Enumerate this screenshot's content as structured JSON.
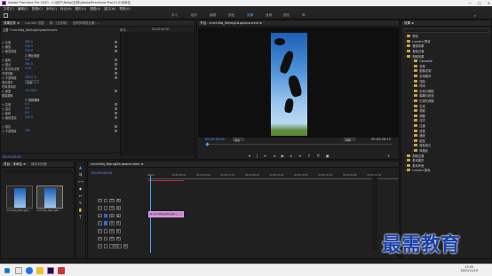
{
  "window": {
    "title": "Adobe Premiere Pro 2020 - C:\\用户\\ftdop\\文档\\Adobe\\Premiere Pro\\14.0\\未命名",
    "controls": [
      "—",
      "□",
      "✕"
    ]
  },
  "menu": [
    "文件(F)",
    "编辑(E)",
    "剪辑(C)",
    "序列(S)",
    "标记(M)",
    "图形(G)",
    "视图(V)",
    "窗口(W)",
    "帮助(H)"
  ],
  "workspaces": [
    {
      "label": "学习",
      "active": false
    },
    {
      "label": "组件",
      "active": false
    },
    {
      "label": "编辑",
      "active": false
    },
    {
      "label": "颜色",
      "active": false
    },
    {
      "label": "效果",
      "active": true
    },
    {
      "label": "音频",
      "active": false
    },
    {
      "label": "图形",
      "active": false
    },
    {
      "label": "库",
      "active": false
    }
  ],
  "effect_controls": {
    "tabs": [
      "效果控件 ≡",
      "Lumetri 范围",
      "源：(无剪辑)",
      "音频剪辑混合器: ..."
    ],
    "clip": "主要 * cnrcrVdq_Stering2d.peacro.mmi",
    "seq": "序列 ...",
    "time": "00:00:00:00",
    "rows": [
      {
        "label": "○ 位置",
        "value": "360.0"
      },
      {
        "label": "○ 缩放",
        "value": "100.0"
      },
      {
        "label": "○ 缩放宽度",
        "value": "100.0"
      },
      {
        "label": "",
        "value": "☑ 等比缩放"
      },
      {
        "label": "○ 旋转",
        "value": "0.0"
      },
      {
        "label": "○ 锚点",
        "value": "360.0"
      },
      {
        "label": "○ 防闪烁滤镜",
        "value": "0.00"
      },
      {
        "label": "不透明度",
        "value": ""
      },
      {
        "label": "○ 不透明度",
        "value": "100.0 %"
      },
      {
        "label": "混合模式",
        "value": "正常"
      },
      {
        "label": "时间重映射",
        "value": ""
      },
      {
        "label": "○ 速度",
        "value": "100.00%"
      },
      {
        "label": "垂直翻转",
        "value": ""
      },
      {
        "label": "",
        "value": "☑ 视频翻转"
      },
      {
        "label": "○ 高度",
        "value": "0.0"
      },
      {
        "label": "○ 溢出",
        "value": "0.0"
      },
      {
        "label": "○ 旋转",
        "value": "0.0"
      },
      {
        "label": "○ 缩放渲染",
        "value": "100.0"
      },
      {
        "label": "○ 描边",
        "value": ""
      },
      {
        "label": "○ 不透明度",
        "value": "100"
      }
    ],
    "footer_time": "00:00:00:00"
  },
  "program": {
    "tab": "节目：cnrcrVdq_Sterng2d.peacro.mmi ≡",
    "timecode": "00:00:00:00",
    "fit": "适合",
    "quality": "完整",
    "duration": "00:00:28:13"
  },
  "project": {
    "tabs": [
      "项目：未命名 ≡",
      "媒体浏览器"
    ],
    "items": [
      {
        "name": "cnrcrVdq_Sterng2d...",
        "duration": "10:0"
      },
      {
        "name": "cnrcrVdq_Sterng2d...",
        "duration": "10:0"
      }
    ]
  },
  "timeline": {
    "tab": "cnrcrVdq_Sterng2d.peacro.mmi ≡",
    "timecode": "00:00:00:00",
    "ticks": [
      "00:00",
      "00:00:05:00",
      "00:00:10:00",
      "00:00:15:00",
      "00:00:20:00",
      "00:00:25:00",
      "00:00:30:00",
      "00:00:35:00",
      "00:00:40:00",
      "00:00:45:00"
    ],
    "tracks": [
      "V3",
      "V2",
      "V1",
      "A1",
      "A2",
      "A3",
      "主声道"
    ],
    "clip": "fx cnrcrVdq_Sterng2d..."
  },
  "effects": {
    "title": "效果 ≡",
    "items": [
      {
        "label": "预设",
        "depth": 0
      },
      {
        "label": "Lumetri 预设",
        "depth": 0
      },
      {
        "label": "音频效果",
        "depth": 0
      },
      {
        "label": "音频过渡",
        "depth": 0
      },
      {
        "label": "视频效果",
        "depth": 0
      },
      {
        "label": "Obsolete",
        "depth": 1
      },
      {
        "label": "变换",
        "depth": 1
      },
      {
        "label": "图像控制",
        "depth": 1
      },
      {
        "label": "实用程序",
        "depth": 1
      },
      {
        "label": "扭曲",
        "depth": 1
      },
      {
        "label": "时间",
        "depth": 1
      },
      {
        "label": "杂色与颗粒",
        "depth": 1
      },
      {
        "label": "模糊与锐化",
        "depth": 1
      },
      {
        "label": "沉浸式视频",
        "depth": 1
      },
      {
        "label": "生成",
        "depth": 1
      },
      {
        "label": "视频",
        "depth": 1
      },
      {
        "label": "调整",
        "depth": 1
      },
      {
        "label": "过时",
        "depth": 1
      },
      {
        "label": "过渡",
        "depth": 1
      },
      {
        "label": "透视",
        "depth": 1
      },
      {
        "label": "通道",
        "depth": 1
      },
      {
        "label": "键控",
        "depth": 1
      },
      {
        "label": "颜色校正",
        "depth": 1
      },
      {
        "label": "风格化",
        "depth": 1
      },
      {
        "label": "视频过渡",
        "depth": 0
      },
      {
        "label": "基本图形",
        "depth": 0
      },
      {
        "label": "基本声音",
        "depth": 0
      },
      {
        "label": "Lumetri 颜色",
        "depth": 0
      }
    ]
  },
  "watermark": "最需教育",
  "taskbar": {
    "time": "15:35",
    "date": "2021/11/19"
  }
}
